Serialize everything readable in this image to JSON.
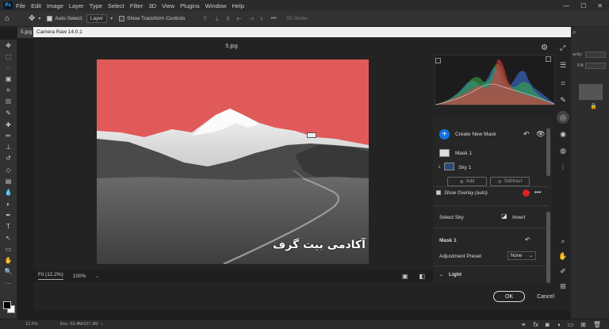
{
  "menubar": {
    "logo": "Ps",
    "items": [
      "File",
      "Edit",
      "Image",
      "Layer",
      "Type",
      "Select",
      "Filter",
      "3D",
      "View",
      "Plugins",
      "Window",
      "Help"
    ],
    "minimize": "—",
    "maximize": "☐",
    "close": "✕"
  },
  "options": {
    "auto_select_label": "Auto-Select:",
    "auto_select_value": "Layer",
    "transform_label": "Show Transform Controls",
    "mode3d_label": "3D Mode:"
  },
  "document": {
    "tab_label": "5.jpg"
  },
  "status": {
    "zoom": "12.5%",
    "doc_info": "Doc: 53.4M/107.3M"
  },
  "right_strip": {
    "opacity_label": "acity:",
    "fill_label": "Fill:"
  },
  "camera_raw": {
    "title": "Camera Raw 14.0.1",
    "filename": "5.jpg",
    "watermark": "آکادمی بیت گرف",
    "fit_label": "Fit (12.2%)",
    "zoom_label": "100%",
    "create_mask": "Create New Mask",
    "mask1": "Mask 1",
    "sky1": "Sky 1",
    "add": "Add",
    "subtract": "Subtract",
    "show_overlay": "Show Overlay (auto)",
    "overlay_color": "#e02020",
    "select_sky": "Select Sky",
    "invert": "Invert",
    "mask_header": "Mask 1",
    "adjustment_preset_label": "Adjustment Preset",
    "adjustment_preset_value": "None",
    "light": "Light",
    "ok": "OK",
    "cancel": "Cancel"
  },
  "colors": {
    "sky_overlay": "#e05a5a",
    "accent_blue": "#1473e6",
    "panel_bg": "#262626"
  }
}
